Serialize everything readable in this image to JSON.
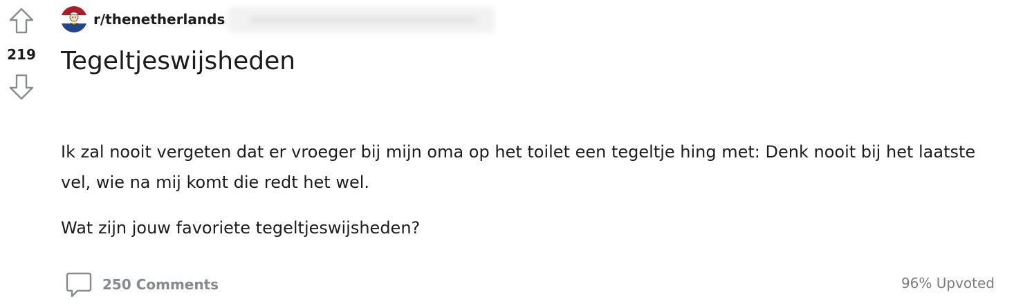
{
  "post": {
    "score": "219",
    "subreddit": "r/thenetherlands",
    "title": "Tegeltjeswijsheden",
    "body": [
      "Ik zal nooit vergeten dat er vroeger bij mijn oma op het toilet een tegeltje hing met: Denk nooit bij het laatste vel, wie na mij komt die redt het wel.",
      "Wat zijn jouw favoriete tegeltjeswijsheden?"
    ],
    "comments_label": "250 Comments",
    "upvoted_label": "96% Upvoted"
  },
  "icons": {
    "upvote": "arrow-up-outline-icon",
    "downvote": "arrow-down-outline-icon",
    "subreddit": "dutch-flag-avatar-icon",
    "comments": "speech-bubble-icon"
  },
  "colors": {
    "text": "#1c1c1c",
    "muted": "#878a8c",
    "flag_red": "#ae1c28",
    "flag_white": "#ffffff",
    "flag_blue": "#21468b",
    "icon_gray": "#878a8c"
  }
}
